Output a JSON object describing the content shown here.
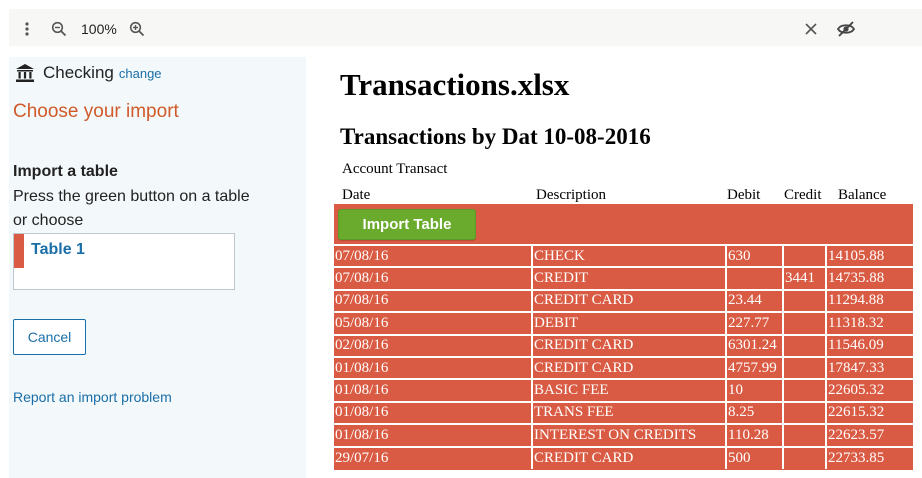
{
  "toolbar": {
    "zoom": "100%",
    "icons": [
      "more-vertical-icon",
      "zoom-out-icon",
      "zoom-in-icon",
      "close-icon",
      "hide-preview-icon"
    ]
  },
  "sidebar": {
    "account_icon": "bank-icon",
    "account_name": "Checking",
    "change_label": "change",
    "choose_title": "Choose your import",
    "import_title": "Import a table",
    "import_desc": "Press the green button on a table or choose",
    "tables": [
      {
        "label": "Table 1"
      }
    ],
    "cancel_label": "Cancel",
    "report_label": "Report an import problem"
  },
  "document": {
    "title": "Transactions.xlsx",
    "subtitle": "Transactions by Dat 10-08-2016",
    "account_label": "Account Transact",
    "headers": [
      "Date",
      "Description",
      "Debit",
      "Credit",
      "Balance"
    ],
    "import_button_label": "Import Table",
    "rows": [
      [
        "07/08/16",
        "CHECK",
        "630",
        "",
        "14105.88"
      ],
      [
        "07/08/16",
        "CREDIT",
        "",
        "3441",
        "14735.88"
      ],
      [
        "07/08/16",
        "CREDIT CARD",
        "23.44",
        "",
        "11294.88"
      ],
      [
        "05/08/16",
        "DEBIT",
        "227.77",
        "",
        "11318.32"
      ],
      [
        "02/08/16",
        "CREDIT CARD",
        "6301.24",
        "",
        "11546.09"
      ],
      [
        "01/08/16",
        "CREDIT CARD",
        "4757.99",
        "",
        "17847.33"
      ],
      [
        "01/08/16",
        "BASIC FEE",
        "10",
        "",
        "22605.32"
      ],
      [
        "01/08/16",
        "TRANS   FEE",
        "8.25",
        "",
        "22615.32"
      ],
      [
        "01/08/16",
        "INTEREST ON CREDITS",
        "110.28",
        "",
        "22623.57"
      ],
      [
        "29/07/16",
        "CREDIT CARD",
        "500",
        "",
        "22733.85"
      ]
    ]
  },
  "colors": {
    "accent_orange": "#d05a2a",
    "table_red": "#d95b43",
    "import_green": "#6aab2e",
    "link_blue": "#1a6fa8",
    "sidebar_bg": "#f3f8fb"
  }
}
